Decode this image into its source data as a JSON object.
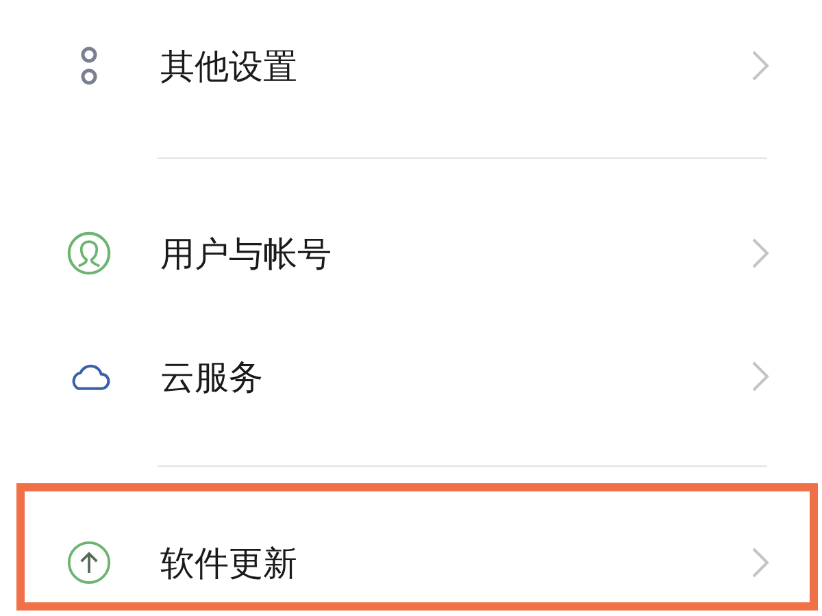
{
  "groups": [
    {
      "items": [
        {
          "kind": "dots",
          "label": "其他设置",
          "highlighted": false
        }
      ]
    },
    {
      "items": [
        {
          "kind": "user",
          "label": "用户与帐号",
          "highlighted": false
        },
        {
          "kind": "cloud",
          "label": "云服务",
          "highlighted": false
        }
      ]
    },
    {
      "items": [
        {
          "kind": "update",
          "label": "软件更新",
          "highlighted": true
        }
      ]
    }
  ]
}
